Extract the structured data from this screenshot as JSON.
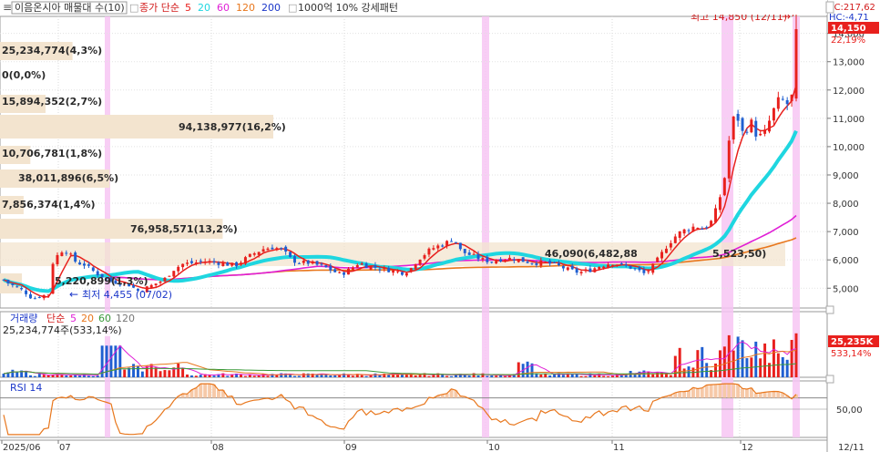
{
  "toolbar": {
    "menu_glyph": "≡",
    "window_glyph": "□",
    "title_full": "이음온시아 매물대 수(10)",
    "price_indicator": "종가 단순",
    "price_ma": [
      "5",
      "20",
      "60",
      "120",
      "200"
    ],
    "condition": "1000억 10% 강세패턴"
  },
  "topright": {
    "lc": "LC:217,62",
    "hc": "HC:-4,71"
  },
  "annotations": {
    "high_label": "최고 14,850 (12/11)",
    "low_label": "최저 4,455 (07/02)",
    "low_arrow": "←",
    "high_arrow": "→",
    "current_price": "14,150",
    "current_pct": "22,19%",
    "vol_current": "25,235K",
    "vol_current_pct": "533,14%"
  },
  "volume_profile": [
    {
      "label": "25,234,774(4,3%)",
      "frac": 0.043
    },
    {
      "label": "0(0,0%)",
      "frac": 0.0
    },
    {
      "label": "15,894,352(2,7%)",
      "frac": 0.027
    },
    {
      "label": "94,138,977(16,2%)",
      "frac": 0.162
    },
    {
      "label": "10,706,781(1,8%)",
      "frac": 0.018
    },
    {
      "label": "38,011,896(6,5%)",
      "frac": 0.065
    },
    {
      "label": "7,856,374(1,4%)",
      "frac": 0.014
    },
    {
      "label": "76,958,571(13,2%)",
      "frac": 0.132
    },
    {
      "label": "46,090(6,482,88",
      "frac": 0.0
    },
    {
      "label": "5,220,899(1,3%)",
      "frac": 0.013
    }
  ],
  "extra_overlay": [
    "5,523,50)"
  ],
  "price_axis": [
    "14,000",
    "13,000",
    "12,000",
    "11,000",
    "10,000",
    "9,000",
    "8,000",
    "7,000",
    "6,000",
    "5,000"
  ],
  "volume_panel": {
    "title": "거래량",
    "indicator": "단순",
    "ma": [
      "5",
      "20",
      "60",
      "120"
    ],
    "summary": "25,234,774주(533,14%)"
  },
  "rsi_panel": {
    "title": "RSI 14",
    "axis": "50,00"
  },
  "date_axis": [
    "2025/06",
    "07",
    "08",
    "09",
    "10",
    "11",
    "12",
    "12/11"
  ],
  "colors": {
    "up": "#e8201d",
    "down": "#1f5fd1",
    "ma5": "#e8201d",
    "ma20": "#1fd6e0",
    "ma60": "#e01fd6",
    "ma120": "#e8771d",
    "highlight": "#f7c6f3",
    "profile": "#f3e4cf"
  },
  "chart_data": {
    "type": "candlestick",
    "price_range": [
      4300,
      14600
    ],
    "high": {
      "value": 14850,
      "date": "12/11"
    },
    "low": {
      "value": 4455,
      "date": "07/02"
    },
    "last_close": 14150,
    "last_change_pct": 22.19,
    "volume_last": "25,234,774",
    "rsi_period": 14
  }
}
